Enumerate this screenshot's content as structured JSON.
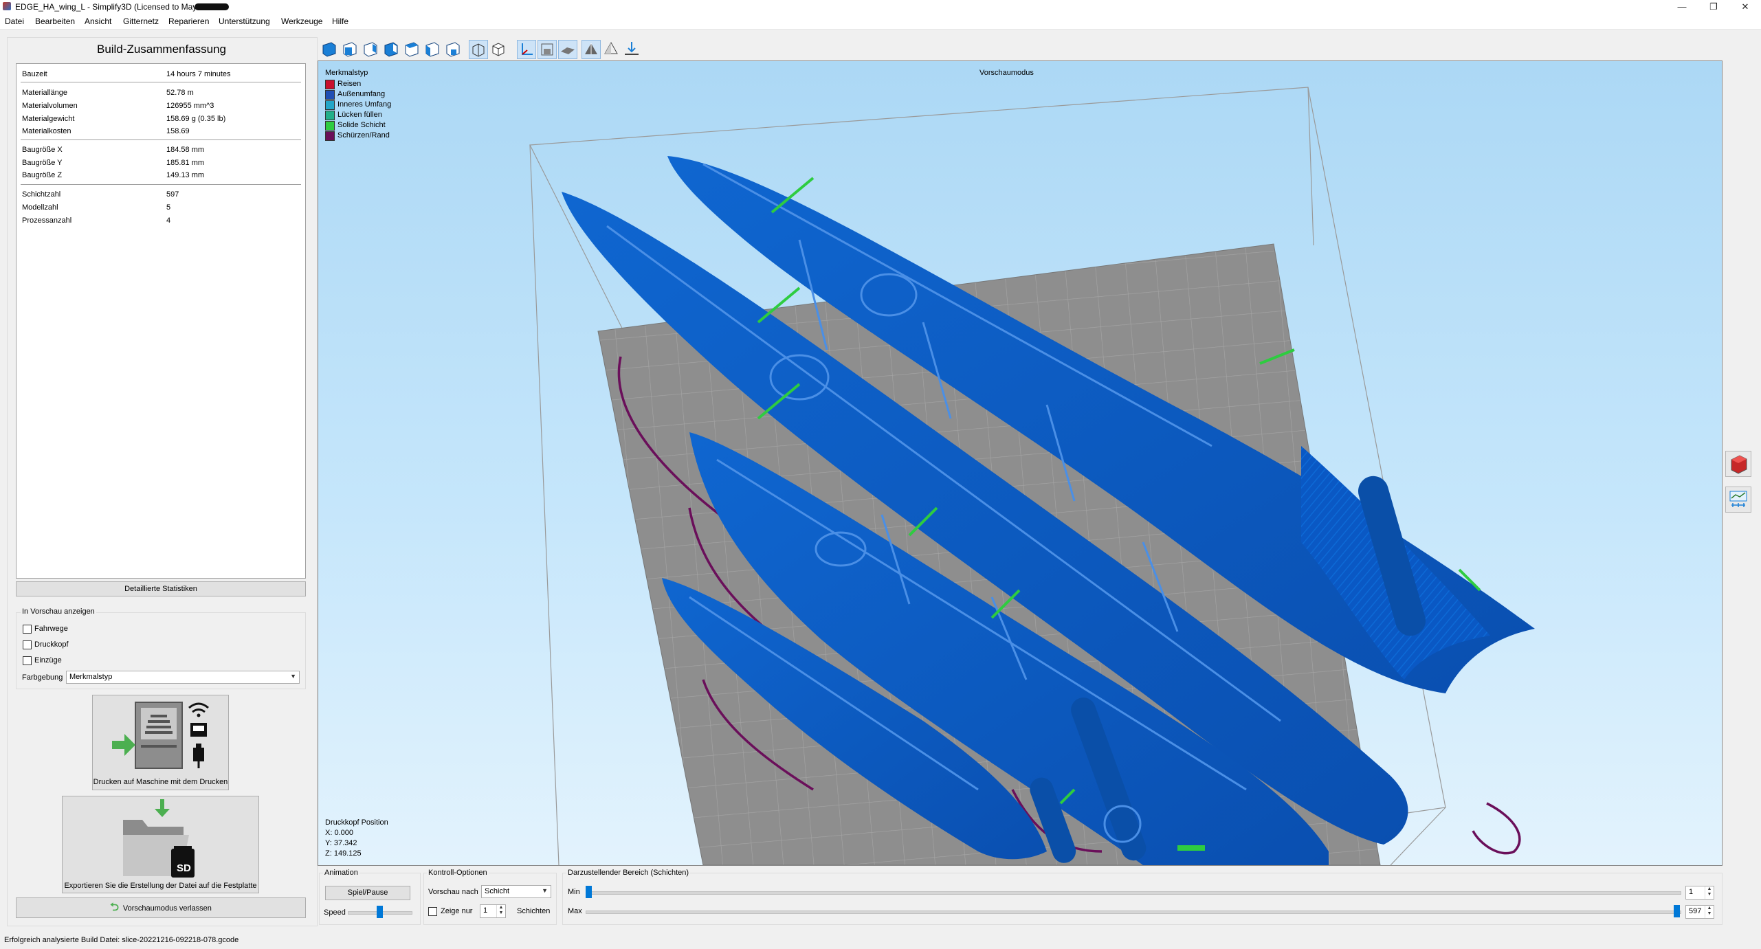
{
  "window": {
    "title": "EDGE_HA_wing_L - Simplify3D (Licensed to Mayk",
    "minimize": "—",
    "maximize": "❐",
    "close": "✕"
  },
  "menu": [
    "Datei",
    "Bearbeiten",
    "Ansicht",
    "Gitternetz",
    "Reparieren",
    "Unterstützung",
    "Werkzeuge",
    "Hilfe"
  ],
  "summary": {
    "title": "Build-Zusammenfassung",
    "rows": [
      {
        "label": "Bauzeit",
        "value": "14 hours 7 minutes"
      },
      {
        "label": "Materiallänge",
        "value": "52.78 m"
      },
      {
        "label": "Materialvolumen",
        "value": "126955 mm^3"
      },
      {
        "label": "Materialgewicht",
        "value": "158.69 g (0.35 lb)"
      },
      {
        "label": "Materialkosten",
        "value": "158.69"
      },
      {
        "label": "Baugröße X",
        "value": "184.58 mm"
      },
      {
        "label": "Baugröße Y",
        "value": "185.81 mm"
      },
      {
        "label": "Baugröße Z",
        "value": "149.13 mm"
      },
      {
        "label": "Schichtzahl",
        "value": "597"
      },
      {
        "label": "Modellzahl",
        "value": "5"
      },
      {
        "label": "Prozessanzahl",
        "value": "4"
      }
    ],
    "details_button": "Detaillierte Statistiken"
  },
  "preview_options": {
    "group_title": "In Vorschau anzeigen",
    "checkboxes": [
      "Fahrwege",
      "Druckkopf",
      "Einzüge"
    ],
    "color_label": "Farbgebung",
    "color_value": "Merkmalstyp"
  },
  "actions": {
    "print_machine": "Drucken auf Maschine mit dem Drucken",
    "export_file": "Exportieren Sie die Erstellung der Datei auf die Festplatte",
    "sd_label": "SD",
    "exit_preview": "Vorschaumodus verlassen"
  },
  "viewport": {
    "mode_label": "Vorschaumodus",
    "legend_title": "Merkmalstyp",
    "legend": [
      {
        "label": "Reisen",
        "color": "#c8102e"
      },
      {
        "label": "Außenumfang",
        "color": "#1f4fb4"
      },
      {
        "label": "Inneres Umfang",
        "color": "#22a6c8"
      },
      {
        "label": "Lücken füllen",
        "color": "#22b08a"
      },
      {
        "label": "Solide Schicht",
        "color": "#2ecc40"
      },
      {
        "label": "Schürzen/Rand",
        "color": "#6a0f5a"
      }
    ],
    "head_position": {
      "title": "Druckkopf Position",
      "x": "X: 0.000",
      "y": "Y: 37.342",
      "z": "Z: 149.125"
    }
  },
  "animation": {
    "group_title": "Animation",
    "play_pause": "Spiel/Pause",
    "speed_label": "Speed"
  },
  "controls": {
    "group_title": "Kontroll-Optionen",
    "preview_by_label": "Vorschau nach",
    "preview_by_value": "Schicht",
    "show_only_label": "Zeige nur",
    "show_only_value": "1",
    "layers_label": "Schichten"
  },
  "range": {
    "group_title": "Darzustellender Bereich (Schichten)",
    "min_label": "Min",
    "max_label": "Max",
    "min_value": "1",
    "max_value": "597",
    "layer_count": 597
  },
  "status": "Erfolgreich analysierte Build Datei: slice-20221216-092218-078.gcode",
  "colors": {
    "part_blue": "#0a58c4",
    "bed_gray": "#8e8e8e",
    "accent": "#0078d7"
  }
}
